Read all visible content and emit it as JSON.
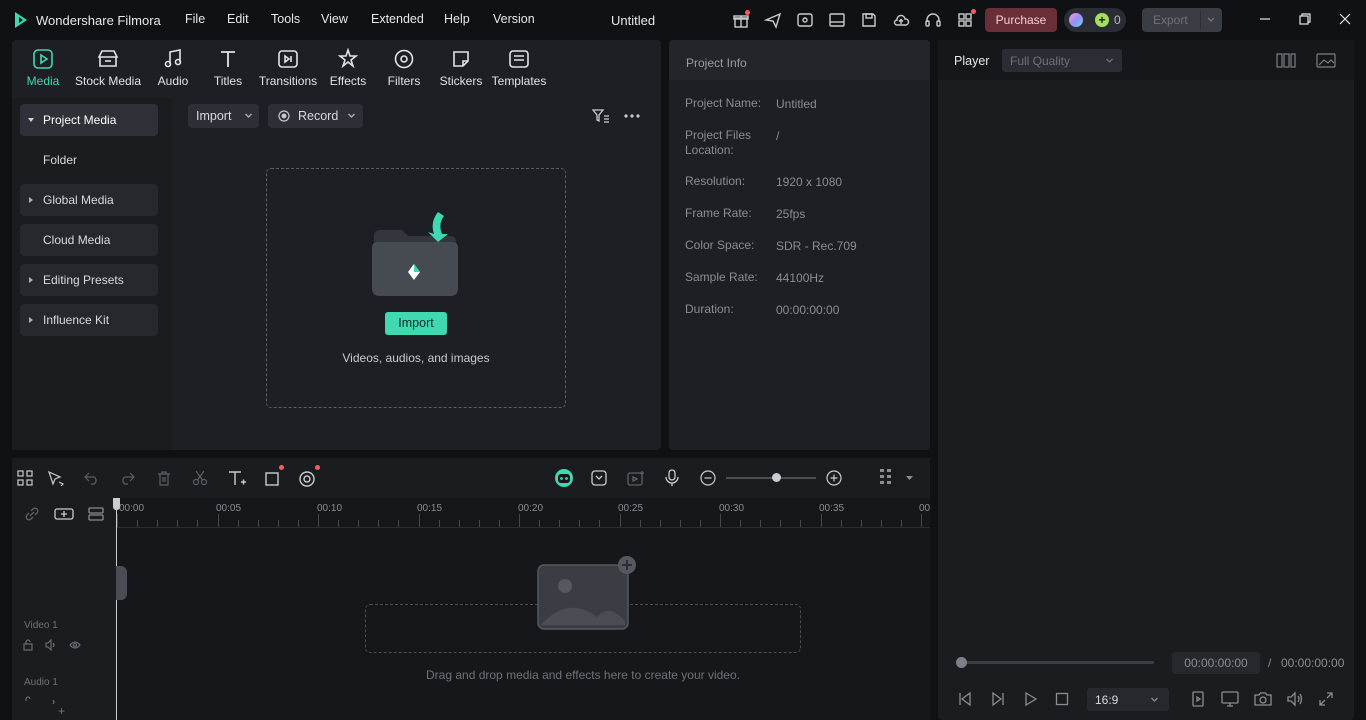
{
  "app": {
    "name": "Wondershare Filmora",
    "title": "Untitled",
    "purchase_label": "Purchase",
    "credits": "0",
    "export_label": "Export"
  },
  "menu": [
    "File",
    "Edit",
    "Tools",
    "View",
    "Extended",
    "Help",
    "Version"
  ],
  "tabs": [
    {
      "label": "Media",
      "icon": "media-icon",
      "active": true
    },
    {
      "label": "Stock Media",
      "icon": "stock-media-icon"
    },
    {
      "label": "Audio",
      "icon": "audio-icon"
    },
    {
      "label": "Titles",
      "icon": "titles-icon"
    },
    {
      "label": "Transitions",
      "icon": "transitions-icon"
    },
    {
      "label": "Effects",
      "icon": "effects-icon"
    },
    {
      "label": "Filters",
      "icon": "filters-icon"
    },
    {
      "label": "Stickers",
      "icon": "stickers-icon"
    },
    {
      "label": "Templates",
      "icon": "templates-icon"
    }
  ],
  "sidebar": {
    "items": [
      {
        "label": "Project Media",
        "caret": true,
        "active": true
      },
      {
        "label": "Folder",
        "caret": false
      },
      {
        "label": "Global Media",
        "caret": true
      },
      {
        "label": "Cloud Media",
        "caret": false
      },
      {
        "label": "Editing Presets",
        "caret": true
      },
      {
        "label": "Influence Kit",
        "caret": true
      }
    ]
  },
  "media": {
    "import_label": "Import",
    "record_label": "Record",
    "drop_import_label": "Import",
    "drop_hint": "Videos, audios, and images"
  },
  "project_info": {
    "title": "Project Info",
    "rows": [
      {
        "label": "Project Name:",
        "value": "Untitled"
      },
      {
        "label": "Project Files Location:",
        "value": "/"
      },
      {
        "label": "Resolution:",
        "value": "1920 x 1080"
      },
      {
        "label": "Frame Rate:",
        "value": "25fps"
      },
      {
        "label": "Color Space:",
        "value": "SDR - Rec.709"
      },
      {
        "label": "Sample Rate:",
        "value": "44100Hz"
      },
      {
        "label": "Duration:",
        "value": "00:00:00:00"
      }
    ]
  },
  "player": {
    "label": "Player",
    "quality": "Full Quality",
    "current_time": "00:00:00:00",
    "separator": "/",
    "total_time": "00:00:00:00",
    "aspect": "16:9",
    "progress": 0
  },
  "timeline": {
    "ruler": [
      "00:00",
      "00:05",
      "00:10",
      "00:15",
      "00:20",
      "00:25",
      "00:30",
      "00:35",
      "00"
    ],
    "tracks": [
      {
        "label": "Video 1"
      },
      {
        "label": "Audio 1"
      }
    ],
    "drop_hint": "Drag and drop media and effects here to create your video.",
    "zoom": 0.55
  },
  "colors": {
    "accent": "#3fd8b0",
    "purchase": "#6a2e37",
    "background": "#0f1115",
    "panel": "#1d1f24"
  }
}
